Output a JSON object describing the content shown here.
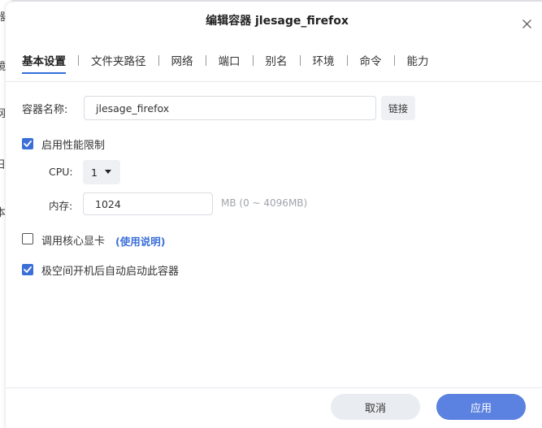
{
  "background": {
    "edge_chars": [
      "器",
      "镜",
      "网",
      "日",
      "本"
    ]
  },
  "dialog": {
    "title": "编辑容器 jlesage_firefox",
    "close_icon": "close-icon"
  },
  "tabs": [
    {
      "label": "基本设置",
      "active": true
    },
    {
      "label": "文件夹路径",
      "active": false
    },
    {
      "label": "网络",
      "active": false
    },
    {
      "label": "端口",
      "active": false
    },
    {
      "label": "别名",
      "active": false
    },
    {
      "label": "环境",
      "active": false
    },
    {
      "label": "命令",
      "active": false
    },
    {
      "label": "能力",
      "active": false
    }
  ],
  "form": {
    "name_label": "容器名称:",
    "name_value": "jlesage_firefox",
    "link_button": "链接",
    "perf_limit_label": "启用性能限制",
    "perf_limit_checked": true,
    "cpu_label": "CPU:",
    "cpu_value": "1",
    "memory_label": "内存:",
    "memory_value": "1024",
    "memory_hint": "MB (0 ~ 4096MB)",
    "gpu_label": "调用核心显卡",
    "gpu_checked": false,
    "gpu_help_link": "(使用说明)",
    "autostart_label": "极空间开机后自动启动此容器",
    "autostart_checked": true
  },
  "footer": {
    "cancel_label": "取消",
    "apply_label": "应用"
  },
  "colors": {
    "accent": "#3b6fd8",
    "apply_button": "#5b82e0",
    "cancel_button": "#e9ecf1"
  }
}
